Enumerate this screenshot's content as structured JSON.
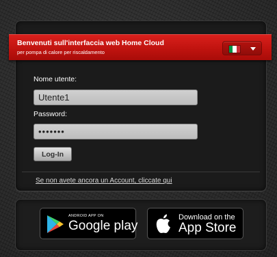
{
  "banner": {
    "title": "Benvenuti sull'interfaccia web Home Cloud",
    "subtitle": "per pompa di calore per riscaldamento",
    "language": {
      "flag_icon": "italy-flag-icon",
      "flag_colors": [
        "#009246",
        "#ffffff",
        "#ce2b37"
      ]
    }
  },
  "login": {
    "username_label": "Nome utente:",
    "username_value": "Utente1",
    "password_label": "Password:",
    "password_value": "•••••••",
    "login_button": "Log-In",
    "register_link": "Se non avete ancora un Account, cliccate qui"
  },
  "stores": {
    "google_play": {
      "small_text": "ANDROID APP ON",
      "big_text": "Google play",
      "icon": "google-play-icon"
    },
    "app_store": {
      "small_text": "Download on the",
      "big_text": "App Store",
      "icon": "apple-icon"
    }
  },
  "colors": {
    "banner_red": "#c0130f",
    "background": "#2a2a2a"
  }
}
